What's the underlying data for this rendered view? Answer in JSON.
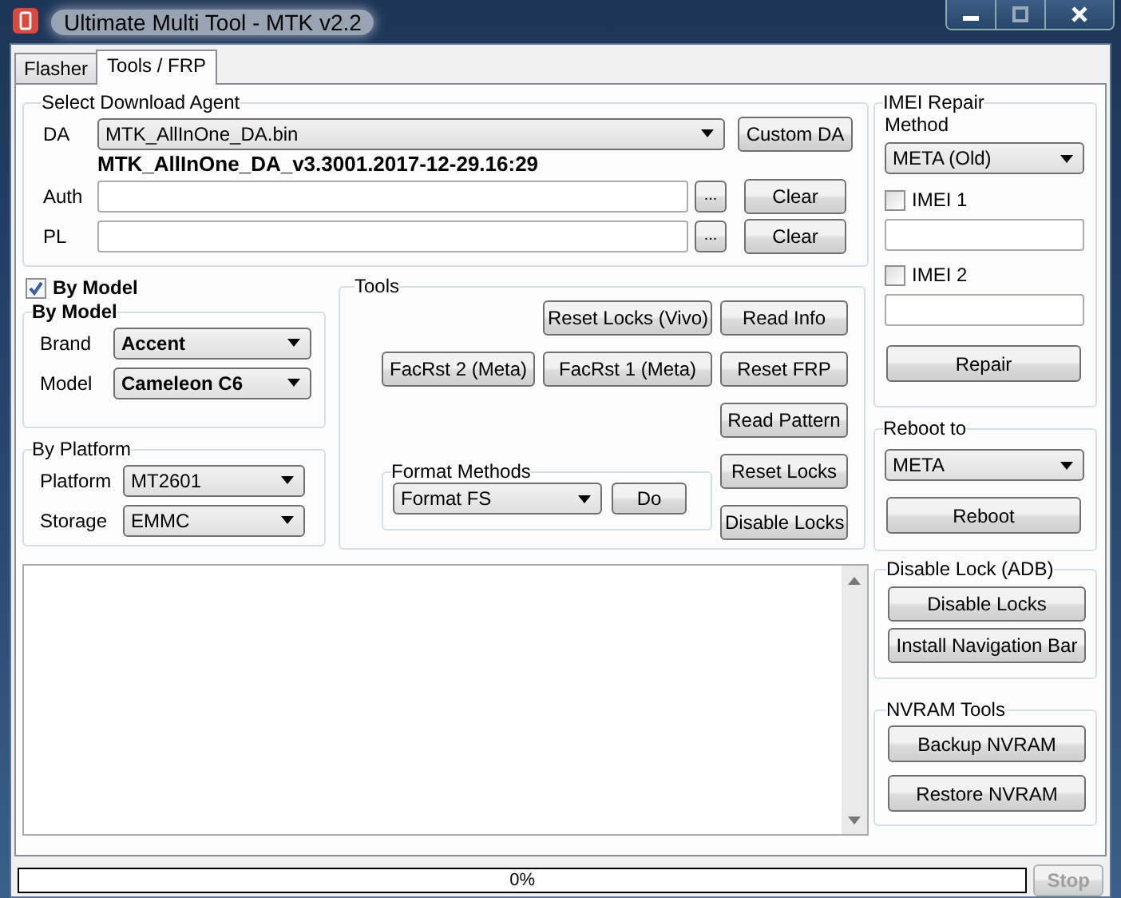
{
  "window": {
    "title": "Ultimate Multi Tool - MTK v2.2"
  },
  "tabs": [
    {
      "label": "Flasher",
      "selected": false
    },
    {
      "label": "Tools / FRP",
      "selected": true
    }
  ],
  "download_agent": {
    "title": "Select Download Agent",
    "da_label": "DA",
    "da_value": "MTK_AllInOne_DA.bin",
    "custom_da_button": "Custom DA",
    "da_version": "MTK_AllInOne_DA_v3.3001.2017-12-29.16:29",
    "paths": [
      {
        "label": "Auth",
        "browse_button": "...",
        "clear_button": "Clear"
      },
      {
        "label": "PL",
        "browse_button": "...",
        "clear_button": "Clear"
      }
    ]
  },
  "by_model_checkbox": {
    "label": "By Model",
    "checked": true
  },
  "by_model": {
    "title": "By Model",
    "fields": [
      {
        "label": "Brand",
        "value": "Accent"
      },
      {
        "label": "Model",
        "value": "Cameleon C6"
      }
    ]
  },
  "by_platform": {
    "title": "By Platform",
    "fields": [
      {
        "label": "Platform",
        "value": "MT2601"
      },
      {
        "label": "Storage",
        "value": "EMMC"
      }
    ]
  },
  "tools": {
    "title": "Tools",
    "reset_locks_vivo": "Reset Locks (Vivo)",
    "read_info": "Read Info",
    "facrst_2": "FacRst 2 (Meta)",
    "facrst_1": "FacRst 1 (Meta)",
    "reset_frp": "Reset FRP",
    "read_pattern": "Read Pattern",
    "reset_locks": "Reset Locks",
    "disable_locks": "Disable Locks",
    "format_methods": {
      "title": "Format Methods",
      "value": "Format FS",
      "button": "Do"
    }
  },
  "imei_repair": {
    "title": "IMEI Repair",
    "method_label": "Method",
    "method_value": "META (Old)",
    "imeis": [
      {
        "label": "IMEI 1",
        "checked": false
      },
      {
        "label": "IMEI 2",
        "checked": false
      }
    ],
    "repair_button": "Repair"
  },
  "reboot": {
    "title": "Reboot to",
    "value": "META",
    "button": "Reboot"
  },
  "disable_lock": {
    "title": "Disable Lock (ADB)",
    "buttons": [
      "Disable Locks",
      "Install Navigation Bar"
    ]
  },
  "nvram": {
    "title": "NVRAM Tools",
    "buttons": [
      "Backup NVRAM",
      "Restore NVRAM"
    ]
  },
  "progress": {
    "level": 0,
    "text": "0%"
  },
  "stop_button": {
    "label": "Stop",
    "disabled": true
  }
}
